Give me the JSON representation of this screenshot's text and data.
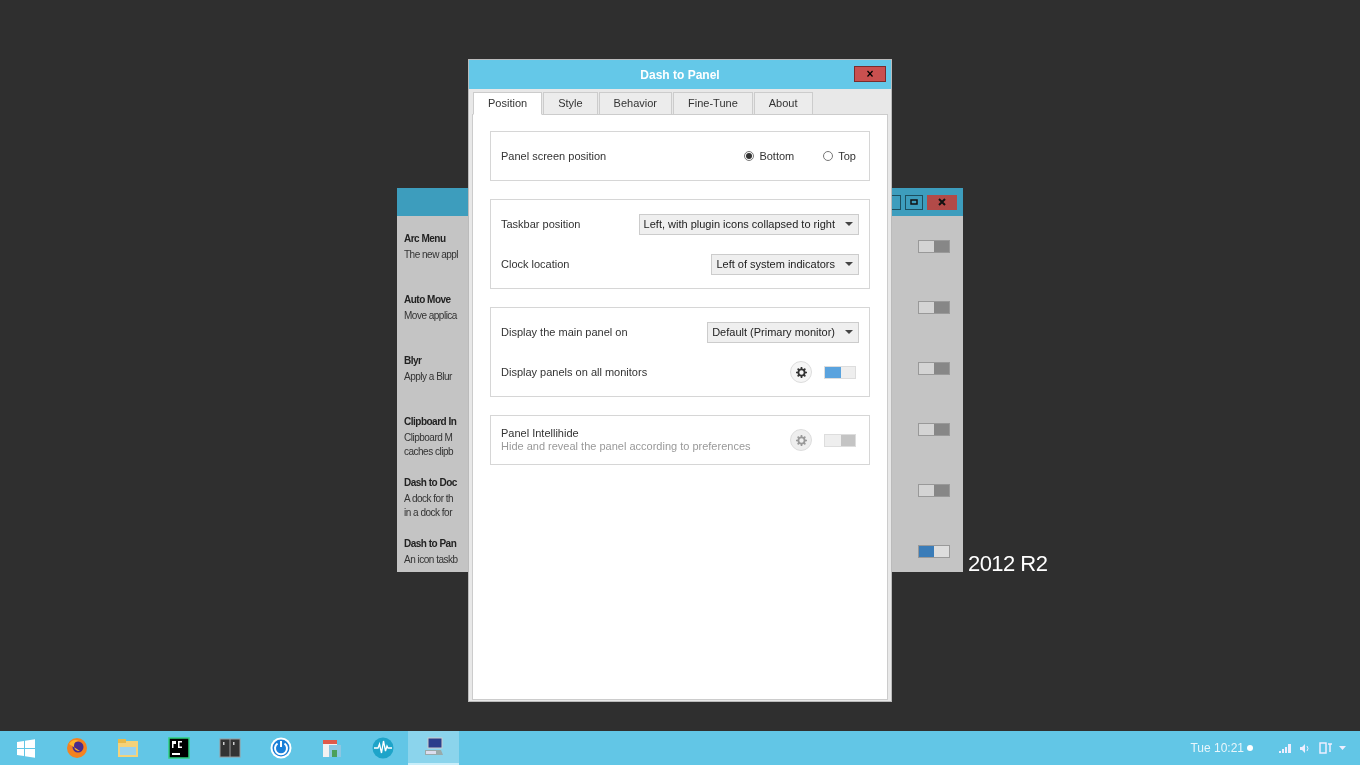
{
  "background_window": {
    "extensions": [
      {
        "name": "Arc Menu",
        "description": [
          "The new appl"
        ],
        "enabled": false
      },
      {
        "name": "Auto Move",
        "description": [
          "Move applica"
        ],
        "enabled": false
      },
      {
        "name": "Blyr",
        "description": [
          "Apply a Blur"
        ],
        "enabled": false
      },
      {
        "name": "Clipboard In",
        "description": [
          "Clipboard M",
          "caches clipb"
        ],
        "enabled": false
      },
      {
        "name": "Dash to Doc",
        "description": [
          "A dock for th",
          "in a dock for"
        ],
        "enabled": false
      },
      {
        "name": "Dash to Pan",
        "description": [
          "An icon taskb"
        ],
        "enabled": true
      }
    ]
  },
  "desktop_text": "2012 R2",
  "dialog": {
    "title": "Dash to Panel",
    "close": "×",
    "tabs": [
      {
        "label": "Position",
        "selected": true
      },
      {
        "label": "Style",
        "selected": false
      },
      {
        "label": "Behavior",
        "selected": false
      },
      {
        "label": "Fine-Tune",
        "selected": false
      },
      {
        "label": "About",
        "selected": false
      }
    ],
    "sections": [
      {
        "rows": [
          {
            "kind": "radio",
            "label": "Panel screen position",
            "options": [
              {
                "label": "Bottom",
                "selected": true
              },
              {
                "label": "Top",
                "selected": false
              }
            ]
          }
        ]
      },
      {
        "rows": [
          {
            "kind": "dropdown",
            "label": "Taskbar position",
            "value": "Left, with plugin icons collapsed to right"
          },
          {
            "kind": "dropdown",
            "label": "Clock location",
            "value": "Left of system indicators"
          }
        ]
      },
      {
        "rows": [
          {
            "kind": "dropdown",
            "label": "Display the main panel on",
            "value": "Default (Primary monitor)"
          },
          {
            "kind": "switch",
            "label": "Display panels on all monitors",
            "on": true
          }
        ]
      },
      {
        "rows": [
          {
            "kind": "switch",
            "label": "Panel Intellihide",
            "description": "Hide and reveal the panel according to preferences",
            "on": false
          }
        ]
      }
    ]
  },
  "taskbar": {
    "apps": [
      {
        "kind": "start",
        "selected": false
      },
      {
        "kind": "browser",
        "selected": false
      },
      {
        "kind": "files",
        "selected": false
      },
      {
        "kind": "ide",
        "selected": false
      },
      {
        "kind": "split",
        "selected": false
      },
      {
        "kind": "power",
        "selected": false
      },
      {
        "kind": "store",
        "selected": false
      },
      {
        "kind": "waveform",
        "selected": false
      },
      {
        "kind": "computer",
        "selected": true
      }
    ],
    "clock": "Tue 10:21"
  }
}
